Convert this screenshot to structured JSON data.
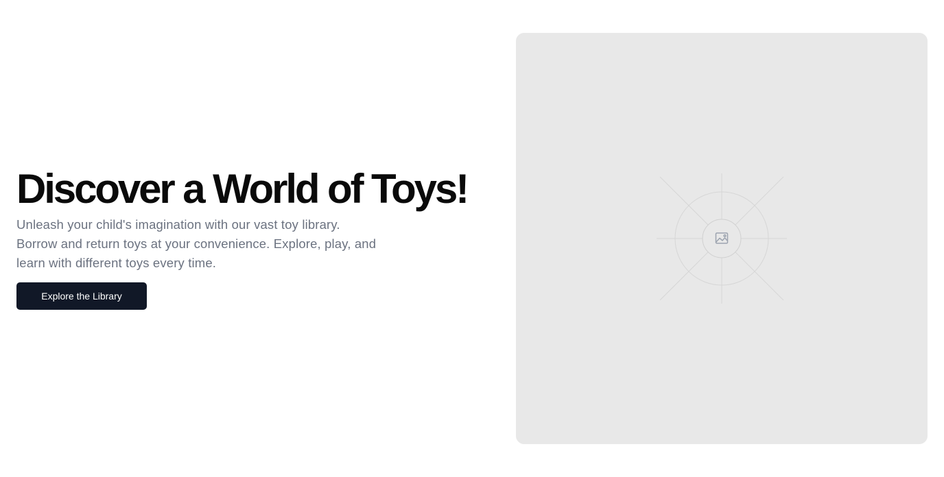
{
  "hero": {
    "headline": "Discover a World of Toys!",
    "subtext_lines": [
      "Unleash your child's imagination with our vast toy library.",
      "Borrow and return toys at your convenience. Explore, play, and",
      "learn with different toys every time."
    ],
    "cta_label": "Explore the Library"
  },
  "image": {
    "icon": "image-icon"
  },
  "colors": {
    "headline": "#0a0a0a",
    "subtext": "#6b7280",
    "button_bg": "#111827",
    "button_text": "#ffffff",
    "placeholder_bg": "#e8e8e8"
  }
}
